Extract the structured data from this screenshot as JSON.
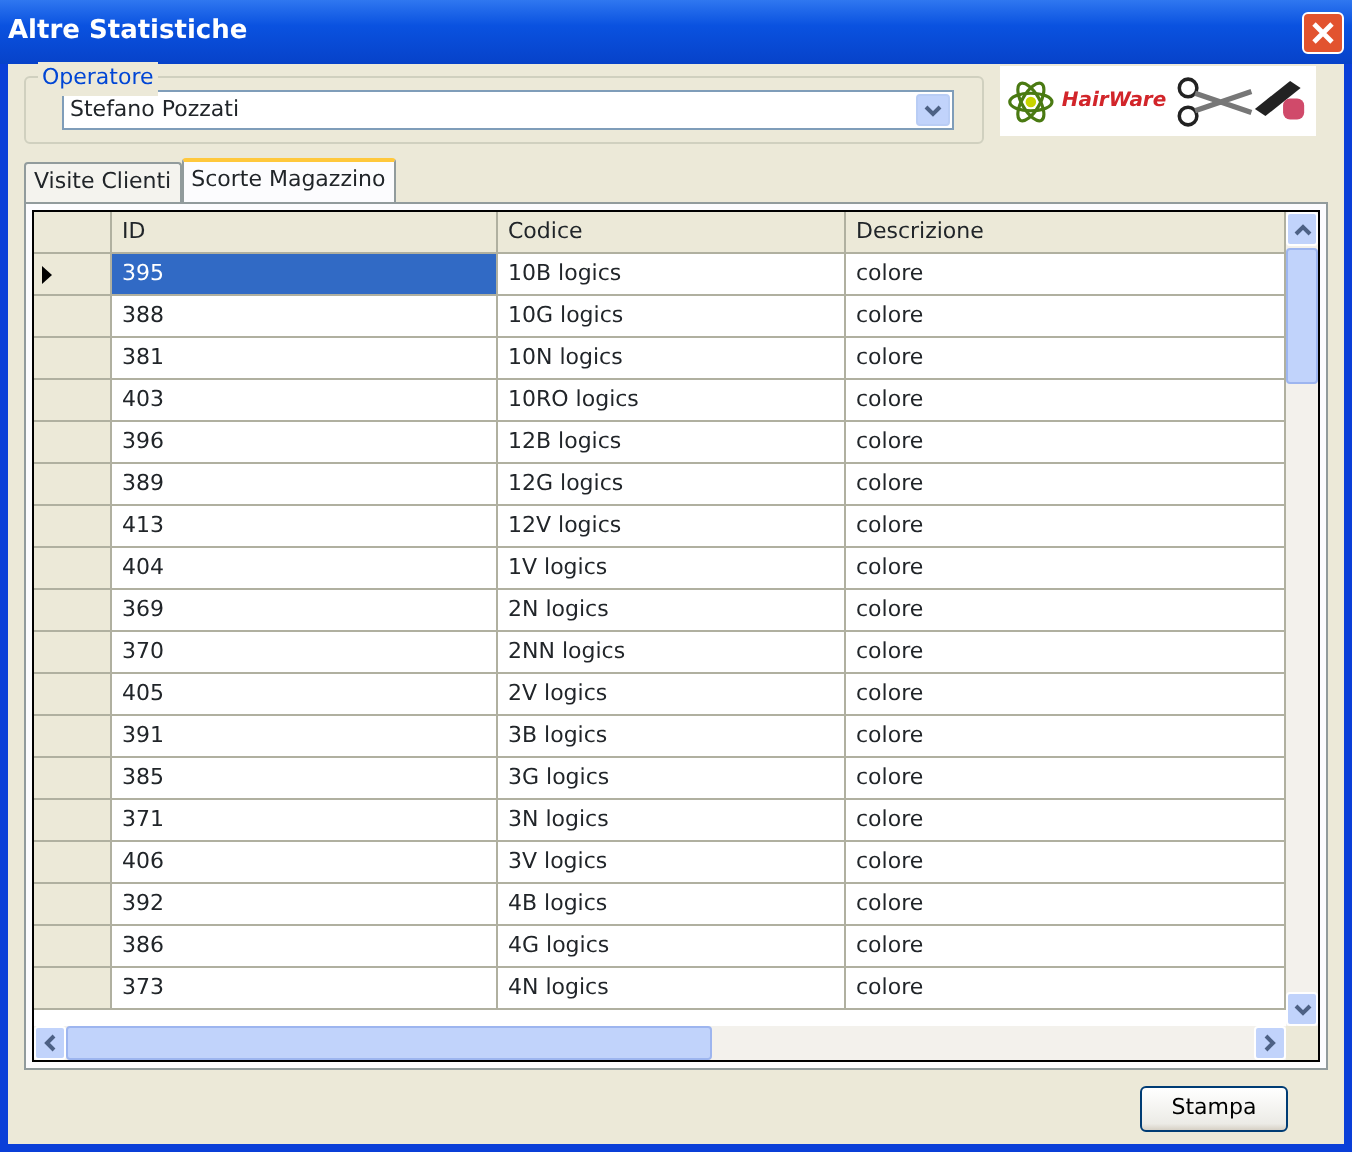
{
  "window": {
    "title": "Altre Statistiche"
  },
  "operator": {
    "label": "Operatore",
    "value": "Stefano Pozzati"
  },
  "logo": {
    "text": "HairWare"
  },
  "tabs": [
    {
      "label": "Visite Clienti",
      "selected": false
    },
    {
      "label": "Scorte Magazzino",
      "selected": true
    }
  ],
  "table": {
    "columns": [
      "ID",
      "Codice",
      "Descrizione"
    ],
    "rows": [
      {
        "id": "395",
        "codice": "10B logics",
        "descrizione": "colore",
        "selected": true
      },
      {
        "id": "388",
        "codice": "10G logics",
        "descrizione": "colore",
        "selected": false
      },
      {
        "id": "381",
        "codice": "10N logics",
        "descrizione": "colore",
        "selected": false
      },
      {
        "id": "403",
        "codice": "10RO logics",
        "descrizione": "colore",
        "selected": false
      },
      {
        "id": "396",
        "codice": "12B logics",
        "descrizione": "colore",
        "selected": false
      },
      {
        "id": "389",
        "codice": "12G logics",
        "descrizione": "colore",
        "selected": false
      },
      {
        "id": "413",
        "codice": "12V logics",
        "descrizione": "colore",
        "selected": false
      },
      {
        "id": "404",
        "codice": "1V logics",
        "descrizione": "colore",
        "selected": false
      },
      {
        "id": "369",
        "codice": "2N logics",
        "descrizione": "colore",
        "selected": false
      },
      {
        "id": "370",
        "codice": "2NN logics",
        "descrizione": "colore",
        "selected": false
      },
      {
        "id": "405",
        "codice": "2V logics",
        "descrizione": "colore",
        "selected": false
      },
      {
        "id": "391",
        "codice": "3B logics",
        "descrizione": "colore",
        "selected": false
      },
      {
        "id": "385",
        "codice": "3G logics",
        "descrizione": "colore",
        "selected": false
      },
      {
        "id": "371",
        "codice": "3N logics",
        "descrizione": "colore",
        "selected": false
      },
      {
        "id": "406",
        "codice": "3V logics",
        "descrizione": "colore",
        "selected": false
      },
      {
        "id": "392",
        "codice": "4B logics",
        "descrizione": "colore",
        "selected": false
      },
      {
        "id": "386",
        "codice": "4G logics",
        "descrizione": "colore",
        "selected": false
      },
      {
        "id": "373",
        "codice": "4N logics",
        "descrizione": "colore",
        "selected": false
      }
    ]
  },
  "buttons": [
    "Stampa"
  ]
}
